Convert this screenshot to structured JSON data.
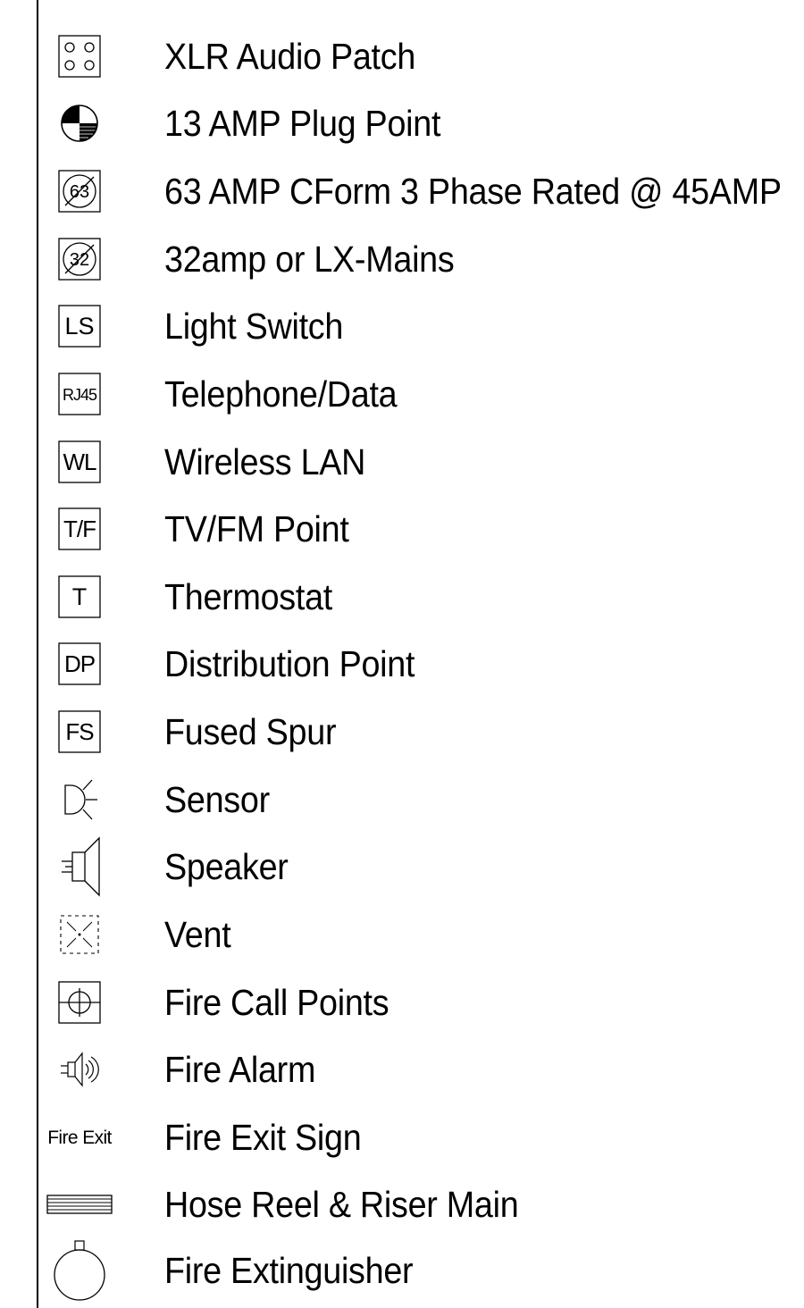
{
  "legend": {
    "items": [
      {
        "icon": "xlr-audio-patch-icon",
        "symbol_text": "",
        "label": "XLR Audio Patch"
      },
      {
        "icon": "plug-point-icon",
        "symbol_text": "",
        "label": "13 AMP Plug Point"
      },
      {
        "icon": "three-phase-socket-icon",
        "symbol_text": "63",
        "label": "63 AMP CForm 3 Phase Rated @ 45AMP"
      },
      {
        "icon": "lx-mains-socket-icon",
        "symbol_text": "32",
        "label": "32amp or LX-Mains"
      },
      {
        "icon": "light-switch-icon",
        "symbol_text": "LS",
        "label": "Light Switch"
      },
      {
        "icon": "telephone-data-icon",
        "symbol_text": "RJ45",
        "label": "Telephone/Data"
      },
      {
        "icon": "wireless-lan-icon",
        "symbol_text": "WL",
        "label": "Wireless LAN"
      },
      {
        "icon": "tv-fm-point-icon",
        "symbol_text": "T/F",
        "label": "TV/FM Point"
      },
      {
        "icon": "thermostat-icon",
        "symbol_text": "T",
        "label": "Thermostat"
      },
      {
        "icon": "distribution-point-icon",
        "symbol_text": "DP",
        "label": "Distribution Point"
      },
      {
        "icon": "fused-spur-icon",
        "symbol_text": "FS",
        "label": "Fused Spur"
      },
      {
        "icon": "sensor-icon",
        "symbol_text": "",
        "label": "Sensor"
      },
      {
        "icon": "speaker-icon",
        "symbol_text": "",
        "label": "Speaker"
      },
      {
        "icon": "vent-icon",
        "symbol_text": "",
        "label": "Vent"
      },
      {
        "icon": "fire-call-point-icon",
        "symbol_text": "",
        "label": "Fire Call Points"
      },
      {
        "icon": "fire-alarm-icon",
        "symbol_text": "",
        "label": "Fire Alarm"
      },
      {
        "icon": "fire-exit-sign-icon",
        "symbol_text": "Fire Exit",
        "label": "Fire Exit Sign"
      },
      {
        "icon": "hose-reel-icon",
        "symbol_text": "",
        "label": "Hose Reel & Riser Main"
      },
      {
        "icon": "fire-extinguisher-icon",
        "symbol_text": "",
        "label": "Fire Extinguisher"
      }
    ]
  }
}
